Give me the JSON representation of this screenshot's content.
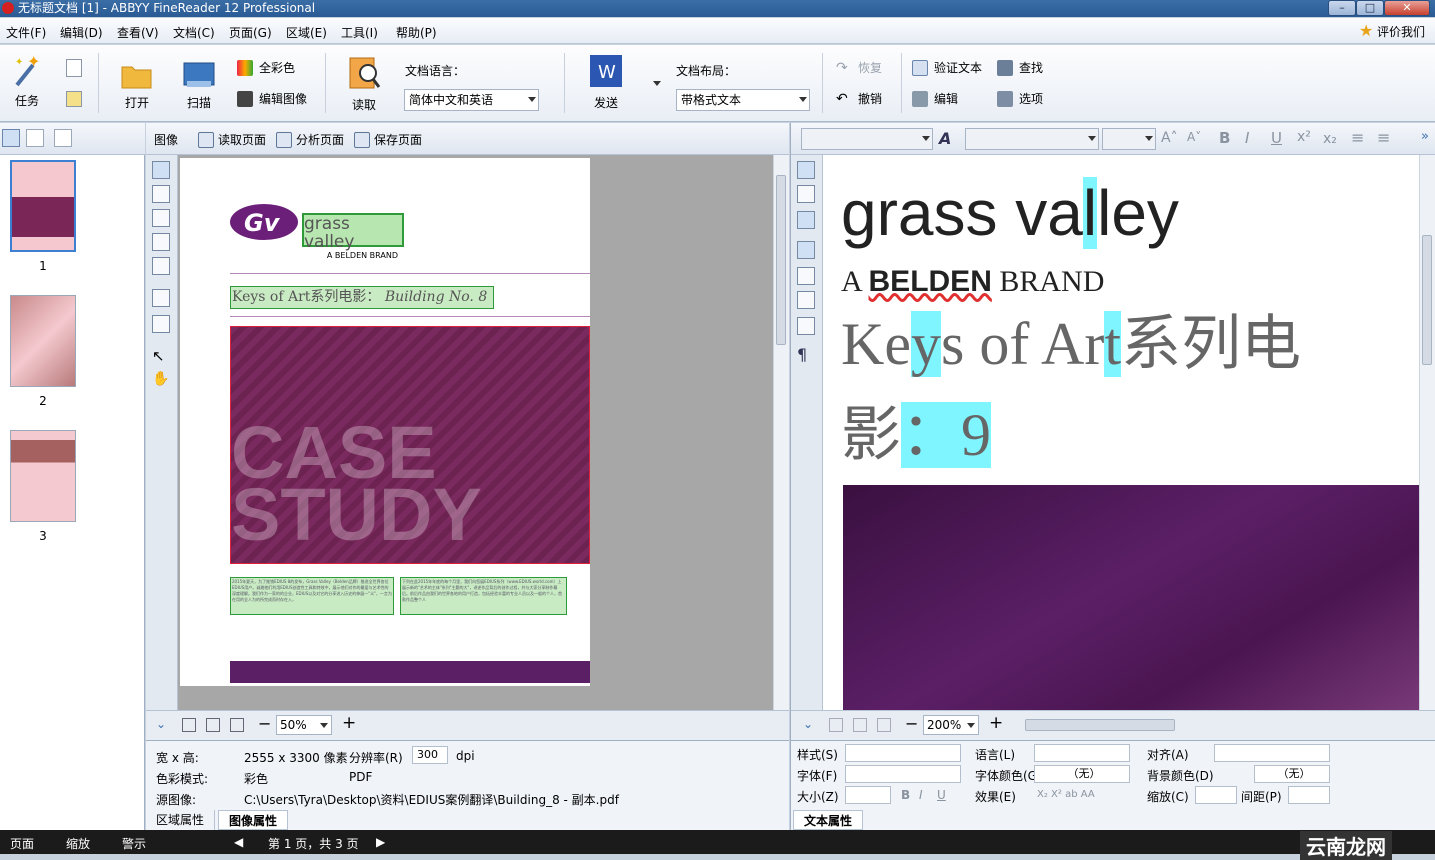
{
  "window": {
    "title": "无标题文档 [1] - ABBYY FineReader 12 Professional"
  },
  "menu": {
    "items": [
      "文件(F)",
      "编辑(D)",
      "查看(V)",
      "文档(C)",
      "页面(G)",
      "区域(E)",
      "工具(I)",
      "帮助(P)"
    ],
    "rate": "评价我们"
  },
  "toolbar": {
    "task": "任务",
    "open": "打开",
    "scan": "扫描",
    "full_color": "全彩色",
    "edit_image": "编辑图像",
    "read": "读取",
    "doc_lang_label": "文档语言：",
    "doc_lang_value": "简体中文和英语",
    "send": "发送",
    "layout_label": "文档布局：",
    "layout_value": "带格式文本",
    "redo": "恢复",
    "undo": "撤销",
    "verify": "验证文本",
    "find": "查找",
    "edit": "编辑",
    "options": "选项"
  },
  "image_pane": {
    "title": "图像",
    "read_page": "读取页面",
    "analyze_page": "分析页面",
    "save_page": "保存页面",
    "zoom": "50%"
  },
  "thumbnails": [
    {
      "label": "1"
    },
    {
      "label": "2"
    },
    {
      "label": "3"
    }
  ],
  "document_page": {
    "logo_text": "grass valley",
    "logo_sub": "A BELDEN BRAND",
    "heading": "Keys of Art系列电影：",
    "heading_italic": "Building No. 8",
    "banner_line1": "CASE",
    "banner_line2": "STUDY",
    "text_block_1": "2015年夏天，为了推销EDIUS 8的发布，Grass Valley（Belden品牌）推进全世界各位EDIUS用户。诚邀他们利用EDIUS创造性工具和特效中，展示他们对作的最爱与艺术性的深度理解。我们作为一家的的企业，EDIUS以及对它的分享进入历史的伸展一\"义\"，一言为在用的全人为的所完成而时存在入，",
    "text_block_2": "下列在此2015年年底的每个月里，我们向您展EDIUS系列（www.EDIUS.world.com）上展示新的\"艺术的主体\"系列\"主题的大\"，讲述作品背后的创作过程，并与大家分享制作幕后。前后作品由我们的世界各地的用户打造，包括经验丰富的专业人员以及一般的个人，首款作品整个人"
  },
  "text_pane": {
    "zoom": "200%",
    "line1": "grass valley",
    "line2_a": "A ",
    "line2_b": "BELDEN",
    "line2_c": " BRAND",
    "line3": "Keys of Art系列电",
    "line4": "影：9"
  },
  "image_props": {
    "size_label": "宽 x 高:",
    "size_value": "2555 x 3300 像素",
    "res_label": "分辨率(R)",
    "res_value": "300",
    "res_unit": "dpi",
    "color_label": "色彩模式:",
    "color_value": "彩色",
    "format": "PDF",
    "source_label": "源图像:",
    "source_value": "C:\\Users\\Tyra\\Desktop\\资料\\EDIUS案例翻译\\Building_8 - 副本.pdf",
    "tab_area": "区域属性",
    "tab_image": "图像属性"
  },
  "text_props": {
    "style": "样式(S)",
    "font": "字体(F)",
    "size": "大小(Z)",
    "language": "语言(L)",
    "font_color": "字体颜色(G)",
    "effect": "效果(E)",
    "align": "对齐(A)",
    "bg_color": "背景颜色(D)",
    "scale": "缩放(C)",
    "spacing": "间距(P)",
    "none1": "（无）",
    "none2": "（无）",
    "tab": "文本属性"
  },
  "status": {
    "page": "页面",
    "zoom": "缩放",
    "warning": "警示",
    "page_info": "第 1 页，共 3 页"
  },
  "watermark": "云南龙网"
}
